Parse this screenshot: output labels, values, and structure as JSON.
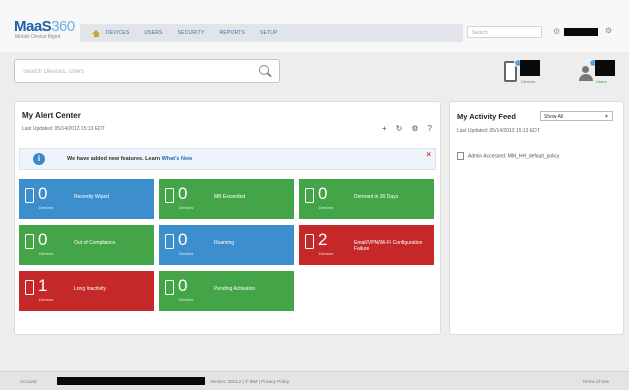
{
  "header": {
    "logo_text": "MaaS",
    "logo_sup": "360",
    "logo_sub": "Mobile Device Mgmt",
    "home_icon": "home-icon",
    "nav_items": [
      "Devices",
      "Users",
      "Security",
      "Reports",
      "Setup"
    ],
    "search_placeholder": "Search",
    "gear_icon": "gear-icon",
    "help_icon": "help-icon"
  },
  "search": {
    "placeholder": "Search Devices, Users"
  },
  "stats": [
    {
      "icon": "device-icon",
      "label": "Devices"
    },
    {
      "icon": "user-icon",
      "label": "Users"
    }
  ],
  "alert_center": {
    "title": "My Alert Center",
    "last_updated": "Last Updated: 05/14/2013 15:13 EDT",
    "tools": [
      "+",
      "↻",
      "⚙",
      "?"
    ],
    "notice": {
      "text": "We have added new features. Learn ",
      "link": "What's New"
    },
    "tiles": [
      {
        "count": "0",
        "unit": "Devices",
        "label": "Recently Wiped",
        "color": "blue"
      },
      {
        "count": "0",
        "unit": "Devices",
        "label": "MB Exceeded",
        "color": "green"
      },
      {
        "count": "0",
        "unit": "Devices",
        "label": "Dormant in 30 Days",
        "color": "green"
      },
      {
        "count": "0",
        "unit": "Devices",
        "label": "Out of Compliance",
        "color": "green"
      },
      {
        "count": "0",
        "unit": "Devices",
        "label": "Roaming",
        "color": "blue"
      },
      {
        "count": "2",
        "unit": "Devices",
        "label": "Email/VPN/Wi-Fi Configuration Failure",
        "color": "red"
      },
      {
        "count": "1",
        "unit": "Devices",
        "label": "Long Inactivity",
        "color": "red"
      },
      {
        "count": "0",
        "unit": "Devices",
        "label": "Pending Activation",
        "color": "green"
      }
    ]
  },
  "activity_feed": {
    "title": "My Activity Feed",
    "filter": "Show All",
    "last_updated": "Last Updated: 05/14/2013 15:13 EDT",
    "items": [
      "Admin Accessed: MM_HH_default_policy"
    ]
  },
  "status_bar": {
    "left": "Account:",
    "mid": "Version: 2013.2 | © IBM | Privacy Policy",
    "right": "Terms of Use"
  }
}
